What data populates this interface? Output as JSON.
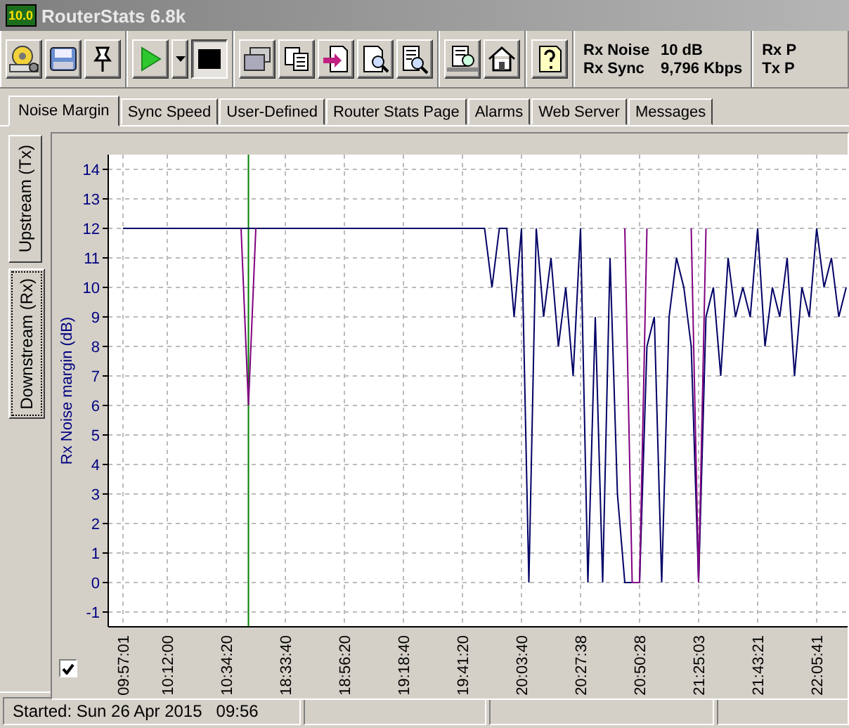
{
  "window": {
    "logo": "10.0",
    "title": "RouterStats 6.8k"
  },
  "toolbar": {
    "groups": [
      {
        "buttons": [
          {
            "kind": "settings",
            "pressed": false
          },
          {
            "kind": "disk",
            "pressed": false
          },
          {
            "kind": "pin",
            "pressed": false
          }
        ]
      },
      {
        "buttons": [
          {
            "kind": "play",
            "pressed": false
          },
          {
            "kind": "dropdown",
            "pressed": false
          },
          {
            "kind": "stop",
            "pressed": true
          }
        ]
      },
      {
        "buttons": [
          {
            "kind": "windows",
            "pressed": false
          },
          {
            "kind": "copy",
            "pressed": false
          },
          {
            "kind": "import",
            "pressed": false
          },
          {
            "kind": "zoom-doc",
            "pressed": false
          },
          {
            "kind": "zoom-list",
            "pressed": false
          }
        ]
      },
      {
        "buttons": [
          {
            "kind": "zoom-report",
            "pressed": false
          },
          {
            "kind": "home",
            "pressed": false
          }
        ]
      },
      {
        "buttons": [
          {
            "kind": "help",
            "pressed": false
          }
        ]
      }
    ],
    "readouts": [
      {
        "label": "Rx Noise",
        "value": "10 dB"
      },
      {
        "label": "Rx Sync",
        "value": "9,796 Kbps"
      }
    ],
    "readouts_cut": [
      "Rx P",
      "Tx P"
    ]
  },
  "tabs": [
    {
      "label": "Noise Margin",
      "selected": true
    },
    {
      "label": "Sync Speed",
      "selected": false
    },
    {
      "label": "User-Defined",
      "selected": false
    },
    {
      "label": "Router Stats Page",
      "selected": false
    },
    {
      "label": "Alarms",
      "selected": false
    },
    {
      "label": "Web Server",
      "selected": false
    },
    {
      "label": "Messages",
      "selected": false
    }
  ],
  "side_tabs": [
    {
      "label": "Upstream (Tx)",
      "selected": false
    },
    {
      "label": "Downstream (Rx)",
      "selected": true
    }
  ],
  "chart": {
    "show_checkbox": {
      "checked": true
    },
    "chart_data": {
      "type": "line",
      "ylabel": "Rx Noise margin (dB)",
      "categories": [
        null,
        null,
        "09:57:01",
        null,
        null,
        null,
        null,
        null,
        "10:12:00",
        null,
        null,
        null,
        null,
        null,
        null,
        null,
        "10:34:20",
        null,
        null,
        null,
        null,
        null,
        null,
        null,
        "18:33:40",
        null,
        null,
        null,
        null,
        null,
        null,
        null,
        "18:56:20",
        null,
        null,
        null,
        null,
        null,
        null,
        null,
        "19:18:40",
        null,
        null,
        null,
        null,
        null,
        null,
        null,
        "19:41:20",
        null,
        null,
        null,
        null,
        null,
        null,
        null,
        "20:03:40",
        null,
        null,
        null,
        null,
        null,
        null,
        null,
        "20:27:38",
        null,
        null,
        null,
        null,
        null,
        null,
        null,
        "20:50:28",
        null,
        null,
        null,
        null,
        null,
        null,
        null,
        "21:25:03",
        null,
        null,
        null,
        null,
        null,
        null,
        null,
        "21:43:21",
        null,
        null,
        null,
        null,
        null,
        null,
        null,
        "22:05:41",
        null,
        null,
        null,
        null
      ],
      "series": [
        {
          "color": "#000066",
          "values": [
            null,
            null,
            12,
            12,
            12,
            12,
            12,
            12,
            12,
            12,
            12,
            12,
            12,
            12,
            12,
            12,
            12,
            12,
            12,
            12,
            12,
            12,
            12,
            12,
            12,
            12,
            12,
            12,
            12,
            12,
            12,
            12,
            12,
            12,
            12,
            12,
            12,
            12,
            12,
            12,
            12,
            12,
            12,
            12,
            12,
            12,
            12,
            12,
            12,
            12,
            12,
            12,
            10,
            12,
            12,
            9,
            12,
            0,
            12,
            9,
            11,
            8,
            10,
            7,
            12,
            0,
            9,
            0,
            11,
            3,
            0,
            0,
            0,
            8,
            9,
            0,
            9,
            11,
            10,
            8,
            0,
            9,
            10,
            7,
            11,
            9,
            10,
            9,
            12,
            8,
            10,
            9,
            11,
            7,
            10,
            9,
            12,
            10,
            11,
            9,
            10
          ]
        },
        {
          "color": "#800080",
          "values": [
            null,
            null,
            null,
            null,
            null,
            null,
            null,
            null,
            null,
            null,
            null,
            null,
            null,
            null,
            null,
            null,
            null,
            null,
            12,
            6,
            12,
            null,
            null,
            null,
            null,
            null,
            null,
            null,
            null,
            null,
            null,
            null,
            null,
            null,
            null,
            null,
            null,
            null,
            null,
            null,
            null,
            null,
            null,
            null,
            null,
            null,
            null,
            null,
            null,
            null,
            null,
            null,
            null,
            null,
            null,
            null,
            null,
            null,
            null,
            null,
            null,
            null,
            null,
            null,
            null,
            null,
            null,
            null,
            null,
            null,
            12,
            0,
            0,
            12,
            null,
            null,
            null,
            null,
            null,
            12,
            0,
            12,
            null,
            null,
            null,
            null,
            null,
            null,
            null,
            null,
            null,
            null,
            null,
            null,
            null,
            null,
            null,
            null,
            null,
            null,
            null
          ]
        }
      ],
      "ylim": [
        -1.5,
        14.5
      ],
      "yticks": [
        -1,
        0,
        1,
        2,
        3,
        4,
        5,
        6,
        7,
        8,
        9,
        10,
        11,
        12,
        13,
        14
      ],
      "grid": true
    }
  },
  "status_bar": {
    "panels": [
      "Started: Sun 26 Apr 2015   09:56"
    ]
  }
}
